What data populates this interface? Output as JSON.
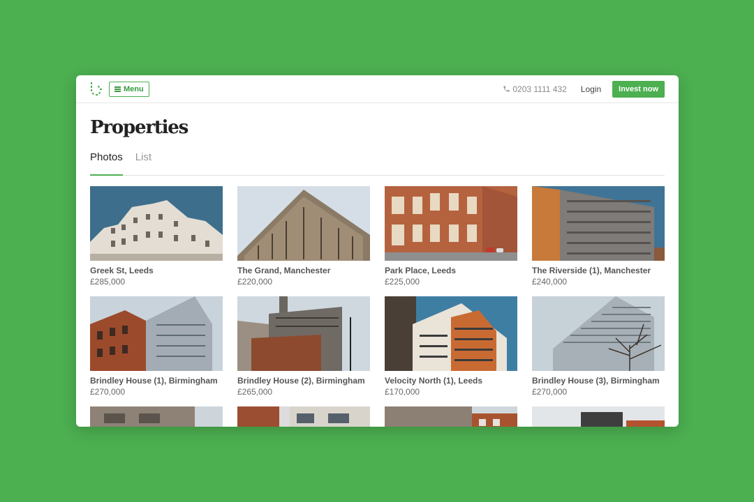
{
  "header": {
    "menu_label": "Menu",
    "phone": "0203 1111 432",
    "login_label": "Login",
    "invest_label": "Invest now",
    "brand_color": "#4caf50"
  },
  "page": {
    "title": "Properties",
    "tabs": [
      {
        "label": "Photos",
        "active": true
      },
      {
        "label": "List",
        "active": false
      }
    ]
  },
  "properties": [
    {
      "name": "Greek St, Leeds",
      "price": "£285,000"
    },
    {
      "name": "The Grand, Manchester",
      "price": "£220,000"
    },
    {
      "name": "Park Place, Leeds",
      "price": "£225,000"
    },
    {
      "name": "The Riverside (1), Manchester",
      "price": "£240,000"
    },
    {
      "name": "Brindley House (1), Birmingham",
      "price": "£270,000"
    },
    {
      "name": "Brindley House (2), Birmingham",
      "price": "£265,000"
    },
    {
      "name": "Velocity North (1), Leeds",
      "price": "£170,000"
    },
    {
      "name": "Brindley House (3), Birmingham",
      "price": "£270,000"
    },
    {
      "name": "",
      "price": ""
    },
    {
      "name": "",
      "price": ""
    },
    {
      "name": "",
      "price": ""
    },
    {
      "name": "",
      "price": ""
    }
  ]
}
